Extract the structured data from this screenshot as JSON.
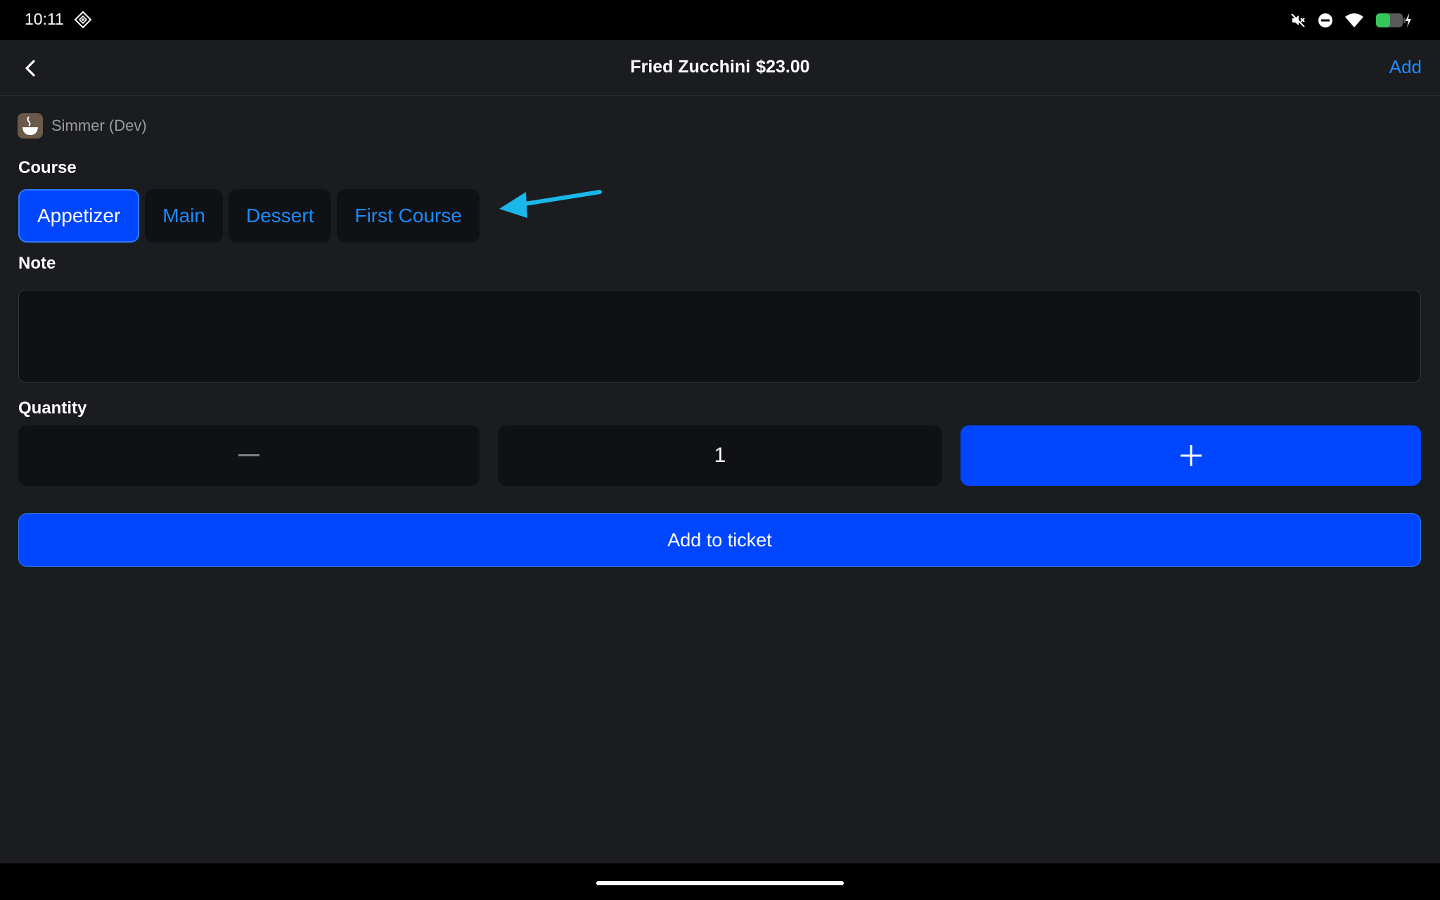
{
  "status_bar": {
    "time": "10:11",
    "icons": [
      "app-diamond-icon",
      "mute-icon",
      "do-not-disturb-icon",
      "wifi-icon",
      "battery-charging-icon"
    ]
  },
  "nav": {
    "title_item": "Fried Zucchini",
    "title_price": "$23.00",
    "add_label": "Add"
  },
  "app": {
    "name": "Simmer (Dev)"
  },
  "course": {
    "label": "Course",
    "options": [
      "Appetizer",
      "Main",
      "Dessert",
      "First Course"
    ],
    "selected": "Appetizer"
  },
  "note": {
    "label": "Note",
    "value": "",
    "placeholder": ""
  },
  "quantity": {
    "label": "Quantity",
    "value": "1"
  },
  "actions": {
    "add_to_ticket_label": "Add to ticket"
  },
  "colors": {
    "accent": "#0046ff",
    "link": "#1a8cff",
    "background": "#1b1c20",
    "field": "#101115",
    "annotation": "#1ab7ea"
  }
}
